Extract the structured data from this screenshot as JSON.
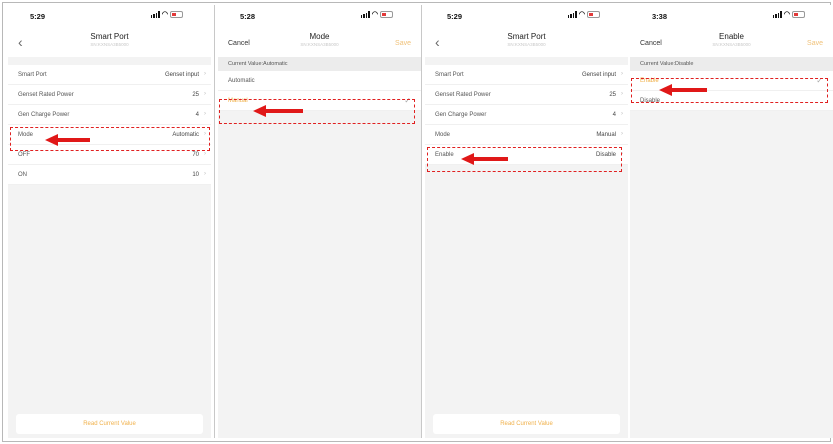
{
  "screens": [
    {
      "time": "5:29",
      "title": "Smart Port",
      "subtitle": "SN:KXNSA3B5000",
      "rows": [
        {
          "label": "Smart Port",
          "value": "Genset input"
        },
        {
          "label": "Genset Rated Power",
          "value": "25"
        },
        {
          "label": "Gen Charge Power",
          "value": "4"
        },
        {
          "label": "Mode",
          "value": "Automatic"
        },
        {
          "label": "OFF",
          "value": "70"
        },
        {
          "label": "ON",
          "value": "10"
        }
      ],
      "read_button": "Read Current Value"
    },
    {
      "time": "5:28",
      "cancel": "Cancel",
      "title": "Mode",
      "subtitle": "SN:KXNSA3B5000",
      "save": "Save",
      "current_value": "Current Value:Automatic",
      "options": [
        {
          "label": "Automatic"
        },
        {
          "label": "Manual"
        }
      ]
    },
    {
      "time": "5:29",
      "title": "Smart Port",
      "subtitle": "SN:KXNSA3B5000",
      "rows": [
        {
          "label": "Smart Port",
          "value": "Genset input"
        },
        {
          "label": "Genset Rated Power",
          "value": "25"
        },
        {
          "label": "Gen Charge Power",
          "value": "4"
        },
        {
          "label": "Mode",
          "value": "Manual"
        },
        {
          "label": "Enable",
          "value": "Disable"
        }
      ],
      "read_button": "Read Current Value"
    },
    {
      "time": "3:38",
      "cancel": "Cancel",
      "title": "Enable",
      "subtitle": "SN:KXNSA3B5000",
      "save": "Save",
      "current_value": "Current Value:Disable",
      "options": [
        {
          "label": "Enable"
        },
        {
          "label": "Disable"
        }
      ]
    }
  ],
  "colors": {
    "accent": "#f0b14b",
    "annotation_red": "#e01818",
    "background": "#f3f3f3"
  },
  "icons": [
    "back-chevron-icon",
    "checkmark-icon",
    "signal-icon",
    "wifi-icon",
    "battery-icon",
    "moon-icon",
    "arrow-annotation-icon"
  ]
}
